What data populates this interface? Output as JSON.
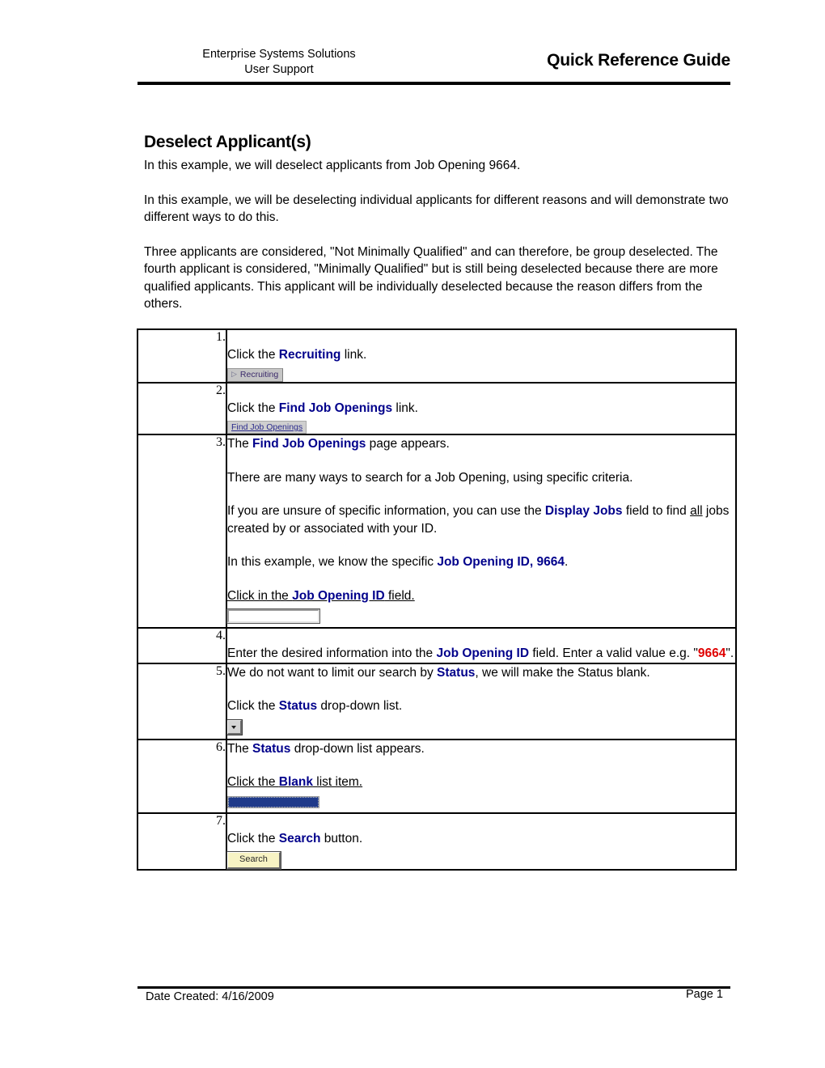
{
  "header": {
    "org_line1": "Enterprise Systems Solutions",
    "org_line2": "User Support",
    "title": "Quick Reference Guide"
  },
  "document": {
    "title": "Deselect Applicant(s)",
    "paragraphs": [
      "In this example, we will deselect applicants from Job Opening 9664.",
      "In this example, we will be deselecting individual applicants for different reasons and will demonstrate two different ways to do this.",
      "Three applicants are considered, \"Not Minimally Qualified\" and can therefore, be group deselected.  The fourth applicant is considered, \"Minimally Qualified\" but is still being deselected because there are more qualified applicants.  This applicant will be individually deselected because the reason differs from the others."
    ]
  },
  "steps": [
    {
      "number": "1.",
      "line1_pre": "Click the ",
      "line1_bold": "Recruiting",
      "line1_post": " link.",
      "widget_label": "Recruiting"
    },
    {
      "number": "2.",
      "line1_pre": "Click the ",
      "line1_bold": "Find Job Openings",
      "line1_post": " link.",
      "widget_label": "Find Job Openings"
    },
    {
      "number": "3.",
      "l1_pre": "The ",
      "l1_bold": "Find Job Openings",
      "l1_post": " page appears.",
      "l2": "There are many ways to search for a Job Opening, using specific criteria.",
      "l3_pre": "If you are unsure of specific information, you can use the ",
      "l3_bold": "Display Jobs",
      "l3_mid": " field to find ",
      "l3_ul": "all",
      "l3_post": " jobs created by or associated with your ID.",
      "l4_pre": "In this example, we know the specific ",
      "l4_bold": "Job Opening ID, 9664",
      "l4_post": ".",
      "l5_pre": "Click in the ",
      "l5_bold": "Job Opening ID",
      "l5_post": " field."
    },
    {
      "number": "4.",
      "l1_pre": "Enter the desired information into the ",
      "l1_bold": "Job Opening ID",
      "l1_mid": " field. Enter a valid value e.g. \"",
      "l1_red": "9664",
      "l1_post": "\"."
    },
    {
      "number": "5.",
      "l1_pre": "We do not want to limit our search by ",
      "l1_bold": "Status",
      "l1_post": ", we will make the Status blank.",
      "l2_pre": "Click the ",
      "l2_bold": "Status",
      "l2_post": " drop-down list."
    },
    {
      "number": "6.",
      "l1_pre": "The ",
      "l1_bold": "Status",
      "l1_post": " drop-down list appears.",
      "l2_pre": "Click the ",
      "l2_bold": "Blank",
      "l2_post": " list item."
    },
    {
      "number": "7.",
      "l1_pre": "Click the ",
      "l1_bold": "Search",
      "l1_post": " button.",
      "button_label": "Search"
    }
  ],
  "footer": {
    "date_created": "Date Created: 4/16/2009",
    "page_number": "Page 1"
  },
  "colors": {
    "accent_blue": "#00008B",
    "alert_red": "#E00000",
    "list_highlight": "#1F3A8A",
    "button_yellow": "#F7F3C4"
  }
}
